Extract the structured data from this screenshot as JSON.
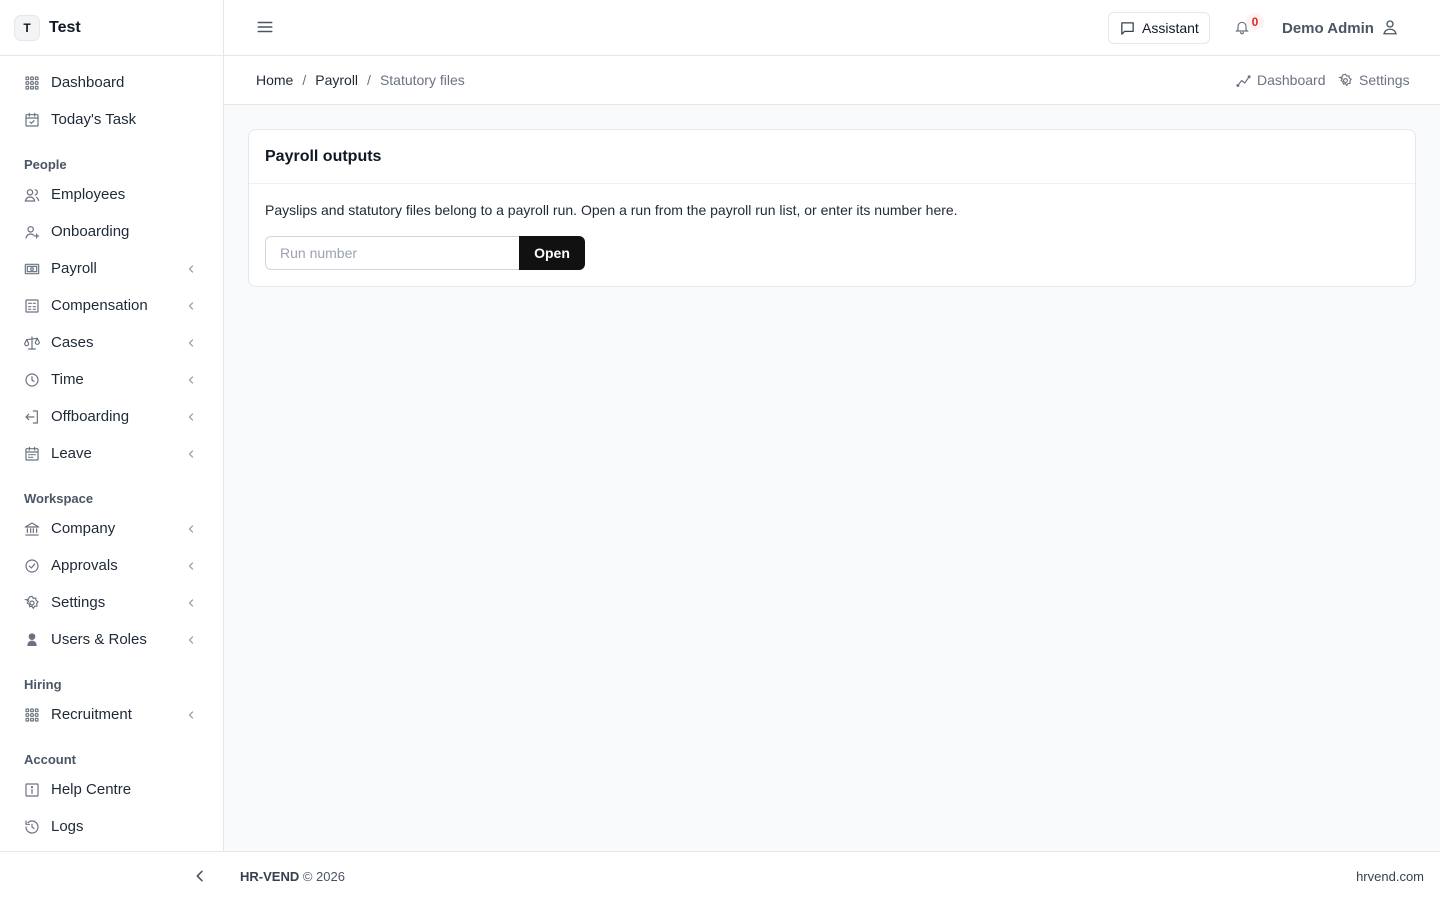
{
  "brand": {
    "initial": "T",
    "name": "Test"
  },
  "sidebar": {
    "top_items": [
      {
        "label": "Dashboard",
        "icon": "grid-icon"
      },
      {
        "label": "Today's Task",
        "icon": "calendar-check-icon"
      }
    ],
    "sections": [
      {
        "title": "People",
        "items": [
          {
            "label": "Employees",
            "icon": "users-icon",
            "has_submenu": false
          },
          {
            "label": "Onboarding",
            "icon": "user-plus-icon",
            "has_submenu": false
          },
          {
            "label": "Payroll",
            "icon": "banknote-icon",
            "has_submenu": true
          },
          {
            "label": "Compensation",
            "icon": "calculator-icon",
            "has_submenu": true
          },
          {
            "label": "Cases",
            "icon": "scale-icon",
            "has_submenu": true
          },
          {
            "label": "Time",
            "icon": "clock-icon",
            "has_submenu": true
          },
          {
            "label": "Offboarding",
            "icon": "log-out-icon",
            "has_submenu": true
          },
          {
            "label": "Leave",
            "icon": "calendar-icon",
            "has_submenu": true
          }
        ]
      },
      {
        "title": "Workspace",
        "items": [
          {
            "label": "Company",
            "icon": "building-icon",
            "has_submenu": true
          },
          {
            "label": "Approvals",
            "icon": "check-circle-icon",
            "has_submenu": true
          },
          {
            "label": "Settings",
            "icon": "gear-icon",
            "has_submenu": true
          },
          {
            "label": "Users & Roles",
            "icon": "user-shield-icon",
            "has_submenu": true
          }
        ]
      },
      {
        "title": "Hiring",
        "items": [
          {
            "label": "Recruitment",
            "icon": "grid-icon",
            "has_submenu": true
          }
        ]
      },
      {
        "title": "Account",
        "items": [
          {
            "label": "Help Centre",
            "icon": "info-icon",
            "has_submenu": false
          },
          {
            "label": "Logs",
            "icon": "history-icon",
            "has_submenu": false
          }
        ]
      }
    ]
  },
  "topbar": {
    "assistant_label": "Assistant",
    "notification_count": "0",
    "user_name": "Demo Admin"
  },
  "breadcrumb": {
    "items": [
      "Home",
      "Payroll"
    ],
    "current": "Statutory files"
  },
  "quick_links": {
    "dashboard": "Dashboard",
    "settings": "Settings"
  },
  "card": {
    "title": "Payroll outputs",
    "description": "Payslips and statutory files belong to a payroll run. Open a run from the payroll run list, or enter its number here.",
    "input_placeholder": "Run number",
    "input_value": "",
    "button_label": "Open"
  },
  "footer": {
    "brand": "HR-VEND",
    "copyright": "© 2026",
    "site": "hrvend.com"
  }
}
